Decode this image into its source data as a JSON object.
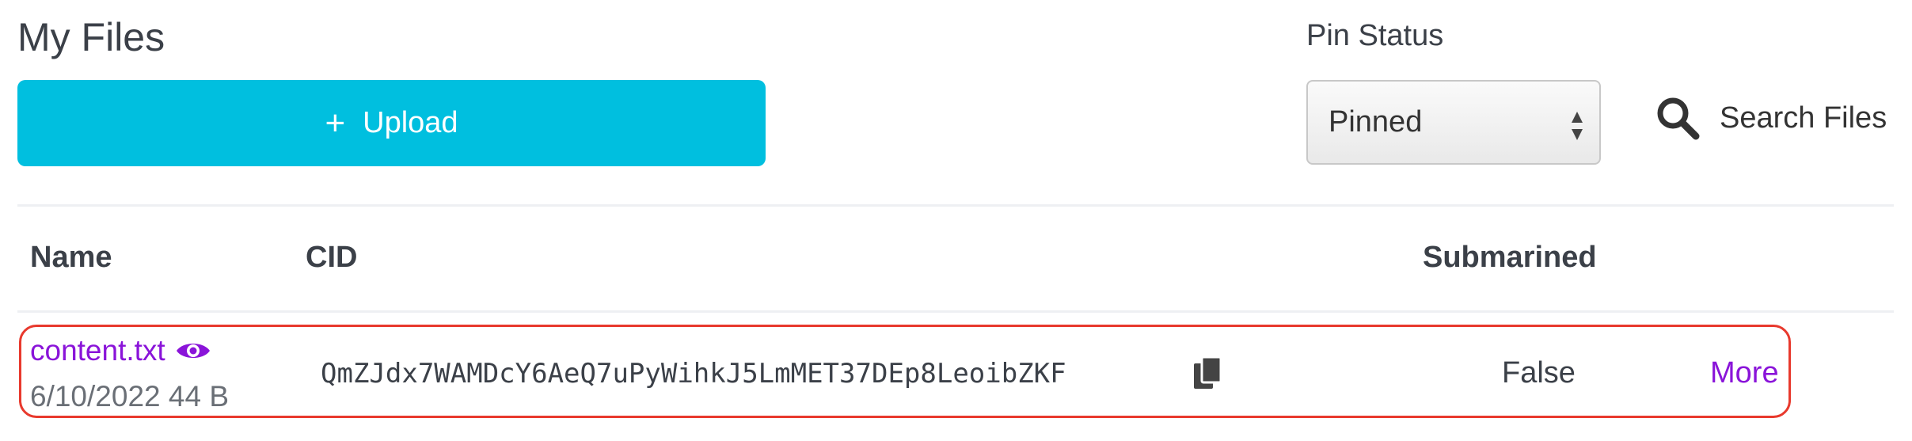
{
  "page": {
    "title": "My Files"
  },
  "upload": {
    "label": "Upload",
    "icon": "plus-icon",
    "color": "#00bfdf"
  },
  "filter": {
    "label": "Pin Status",
    "selected": "Pinned"
  },
  "search": {
    "label": "Search Files",
    "icon": "search-icon"
  },
  "table": {
    "headers": {
      "name": "Name",
      "cid": "CID",
      "submarined": "Submarined"
    },
    "rows": [
      {
        "name": "content.txt",
        "date": "6/10/2022",
        "size": "44 B",
        "cid": "QmZJdx7WAMDcY6AeQ7uPyWihkJ5LmMET37DEp8LeoibZKF",
        "submarined": "False",
        "action": "More"
      }
    ]
  },
  "colors": {
    "accent": "#8a14d9",
    "highlight": "#e8392d"
  }
}
